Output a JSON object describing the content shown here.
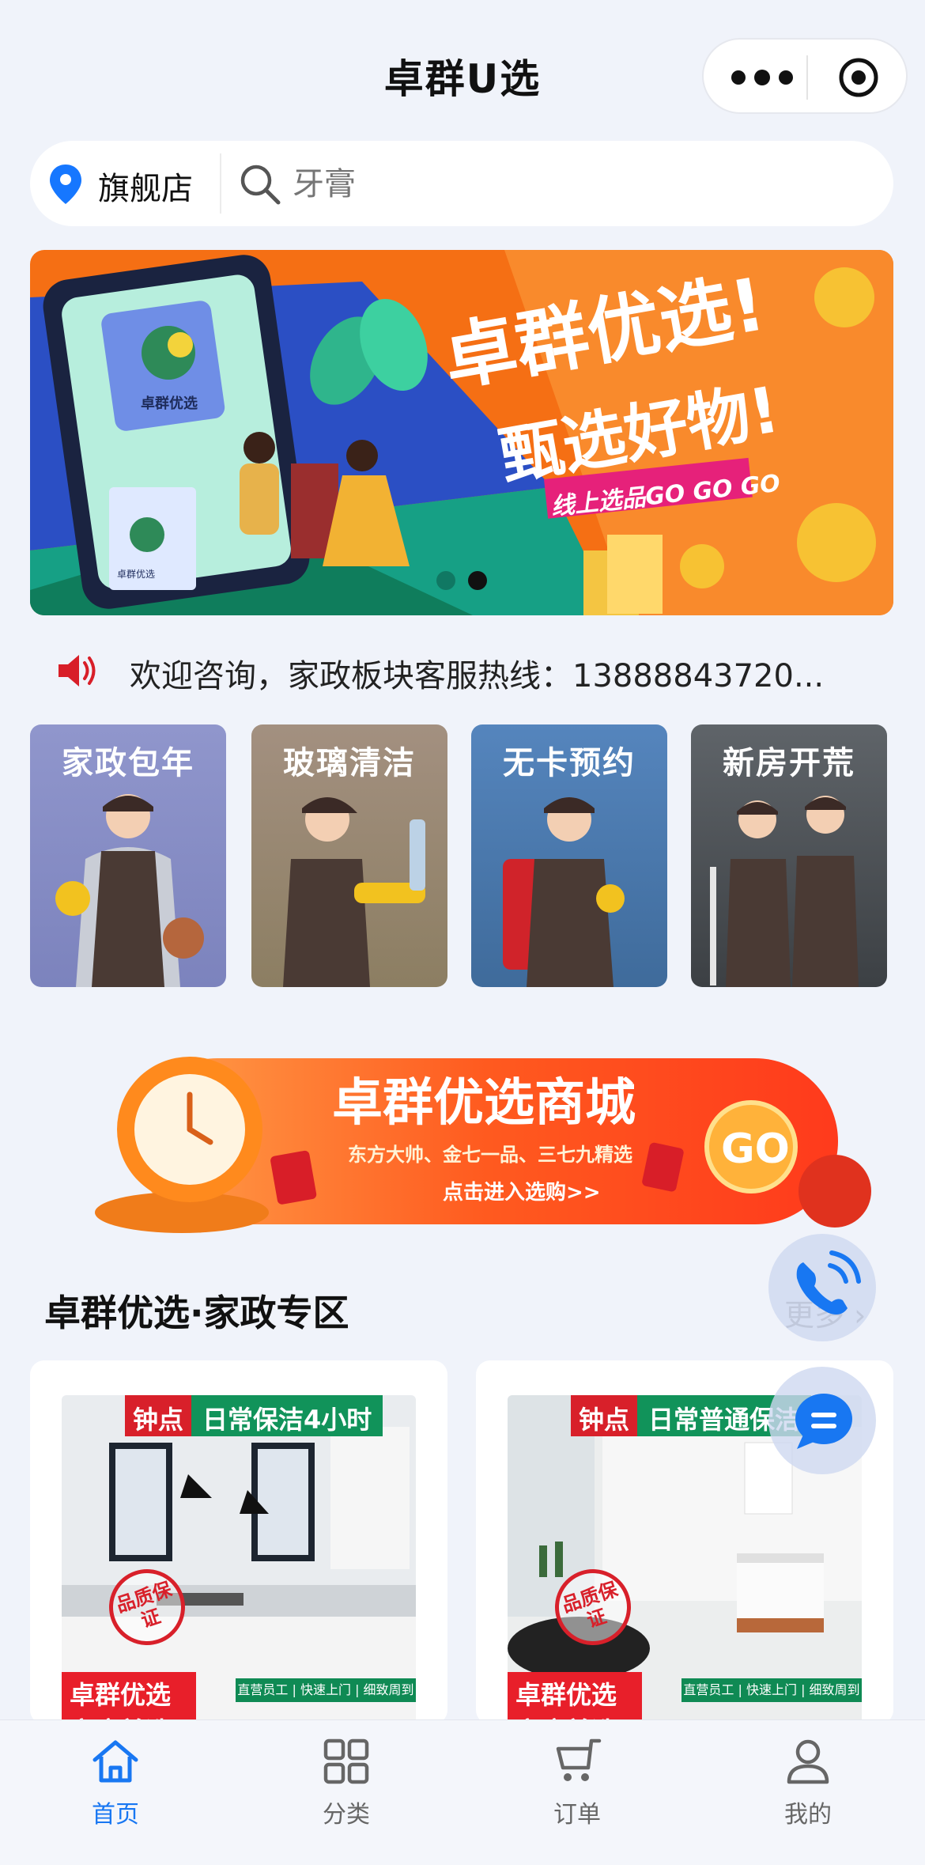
{
  "header": {
    "title": "卓群U选"
  },
  "search": {
    "store_label": "旗舰店",
    "placeholder": "牙膏"
  },
  "banner": {
    "headline": "卓群优选!",
    "subheadline": "甄选好物!",
    "tagline": "线上选品GO GO GO",
    "phone_brand": "卓群优选",
    "bag_brand": "卓群优选",
    "slide_count": 2,
    "active_slide": 2,
    "colors": {
      "bg": "#f56f14",
      "accent": "#e6217a"
    }
  },
  "notice": {
    "text": "欢迎咨询，家政板块客服热线：13888843720..."
  },
  "services": [
    {
      "label": "家政包年",
      "color": "#8b93c8"
    },
    {
      "label": "玻璃清洁",
      "color": "#9f8c78"
    },
    {
      "label": "无卡预约",
      "color": "#4a79ab"
    },
    {
      "label": "新房开荒",
      "color": "#4f5459"
    }
  ],
  "promo": {
    "title": "卓群优选商城",
    "subtitle": "东方大帅、金七一品、三七九精选",
    "cta": "点击进入选购>>",
    "go": "GO"
  },
  "section": {
    "title": "卓群优选·家政专区",
    "more": "更多"
  },
  "products": [
    {
      "tag_red": "钟点",
      "tag_green": "日常保洁4小时",
      "stamp": "品质保证",
      "brand": "卓群优选 家庭首选",
      "strip": "直营员工 | 快速上门 | 细致周到"
    },
    {
      "tag_red": "钟点",
      "tag_green": "日常普通保洁",
      "stamp": "品质保证",
      "brand": "卓群优选 家庭首选",
      "strip": "直营员工 | 快速上门 | 细致周到"
    }
  ],
  "tabbar": [
    {
      "label": "首页",
      "icon": "home-icon",
      "active": true
    },
    {
      "label": "分类",
      "icon": "grid-icon",
      "active": false
    },
    {
      "label": "订单",
      "icon": "cart-icon",
      "active": false
    },
    {
      "label": "我的",
      "icon": "user-icon",
      "active": false
    }
  ]
}
